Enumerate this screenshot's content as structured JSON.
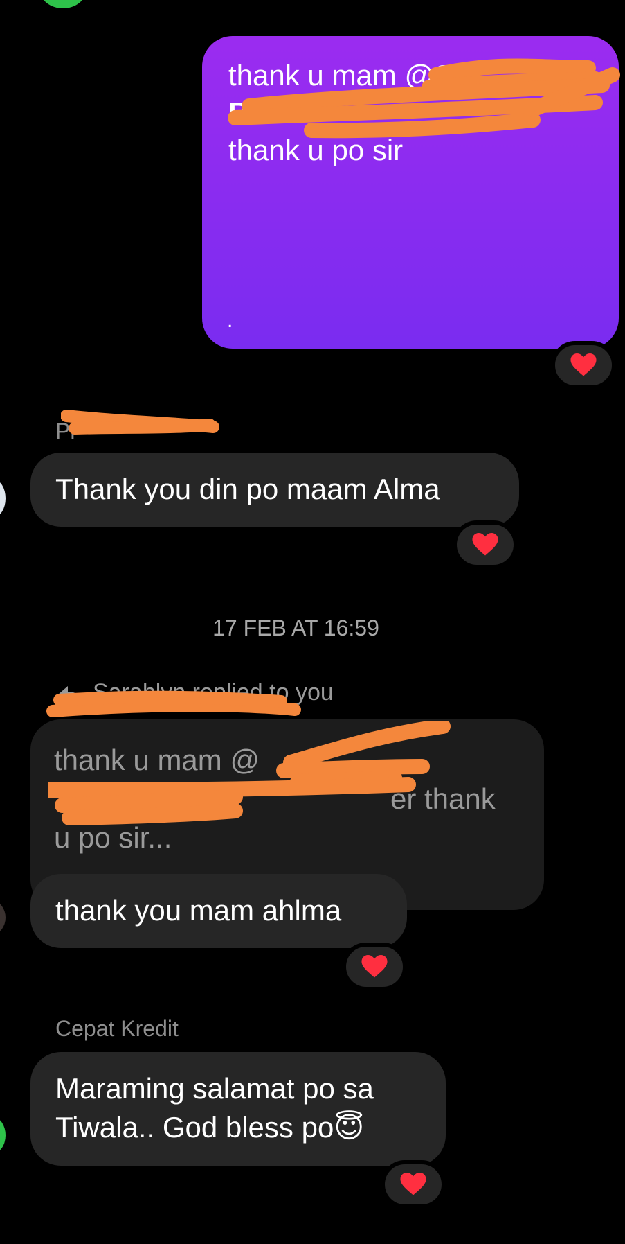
{
  "thread": {
    "outgoing": {
      "line1": "thank u mam @Sa",
      "line2": "Bi",
      "line3": "thank u po sir",
      "dot": ".",
      "gradient_top": "#9b2cf0",
      "gradient_bottom": "#7a2cf0",
      "reaction": "heart"
    },
    "incoming_1": {
      "sender": "Pi",
      "text": "Thank you din po maam Alma",
      "reaction": "heart"
    },
    "timestamp": "17 FEB AT 16:59",
    "reply_context": {
      "label_visible": "Sarahlyn replied to you",
      "quote_line1": "thank u mam @",
      "quote_line2": "er  thank",
      "quote_line3": "u po sir..."
    },
    "incoming_2": {
      "text": "thank you mam ahlma",
      "reaction": "heart"
    },
    "incoming_3": {
      "sender": "Cepat Kredit",
      "line1": "Maraming salamat po sa",
      "line2": "Tiwala.. God bless po",
      "emoji": "😇",
      "reaction": "heart"
    }
  },
  "colors": {
    "heart": "#ff2f40",
    "redaction": "#f4873c",
    "bubble": "#262626"
  }
}
